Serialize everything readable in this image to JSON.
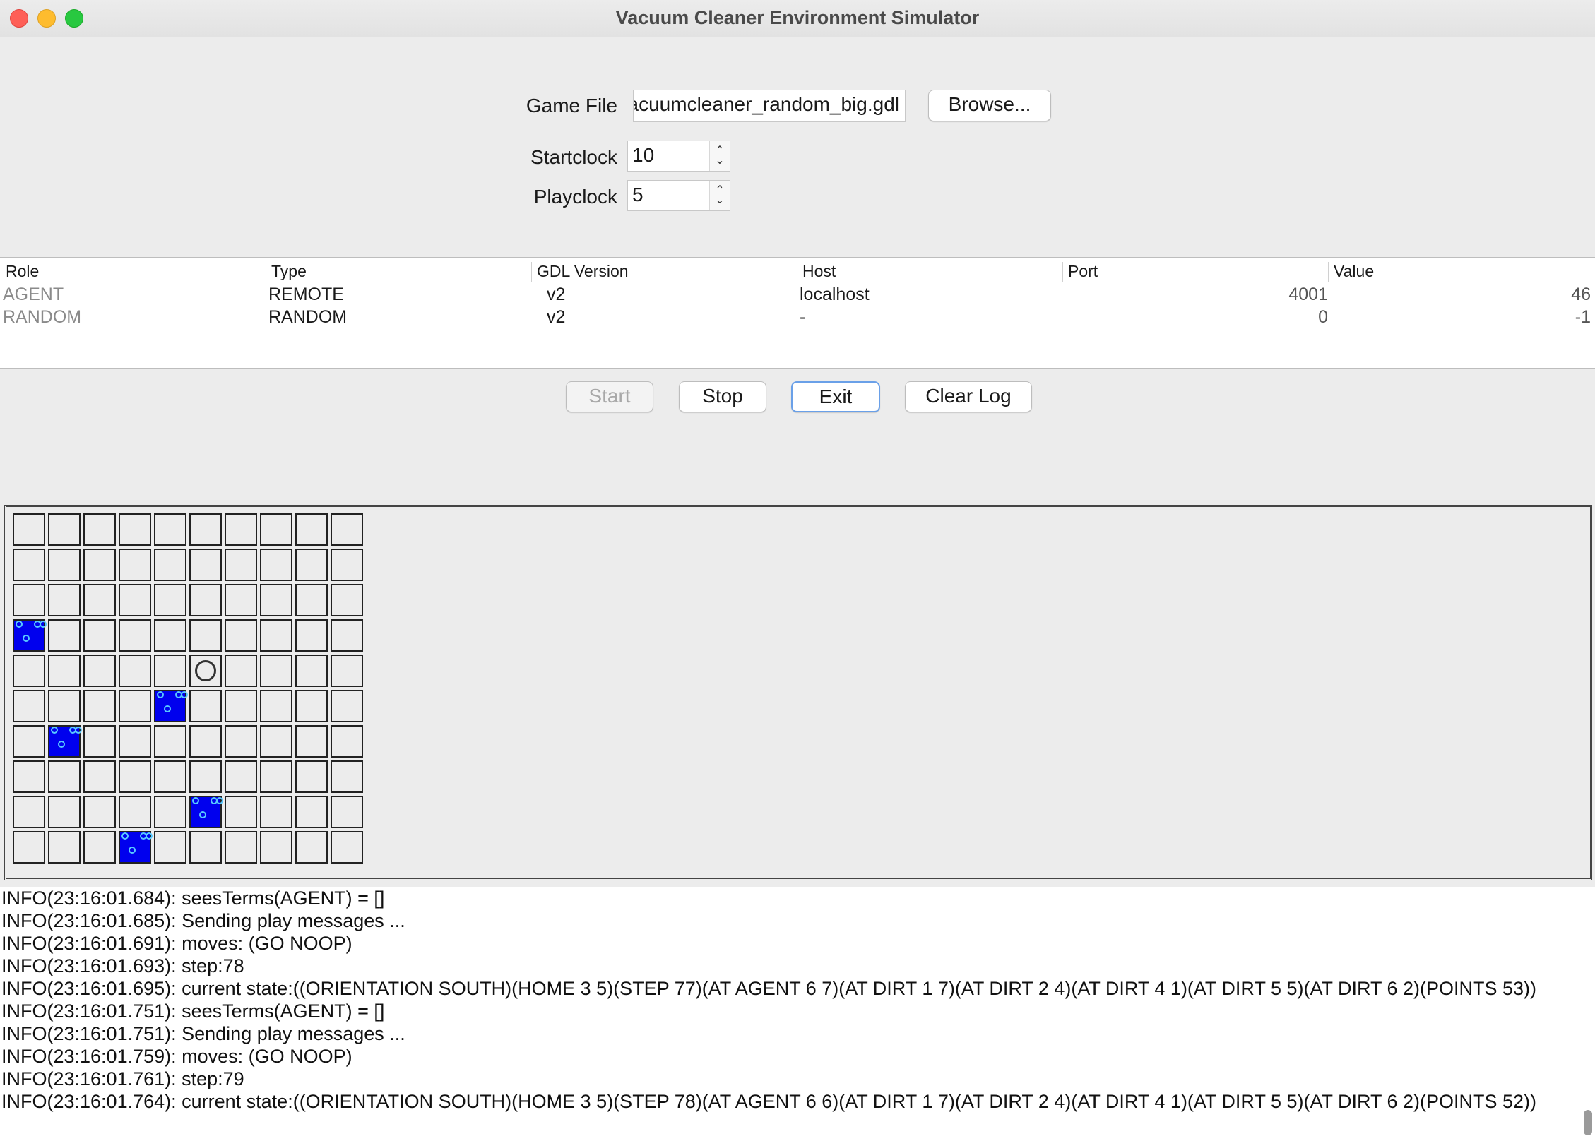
{
  "window": {
    "title": "Vacuum Cleaner Environment Simulator"
  },
  "form": {
    "game_file_label": "Game File",
    "game_file_value": "vacuumcleaner_random_big.gdl",
    "browse_label": "Browse...",
    "startclock_label": "Startclock",
    "startclock_value": "10",
    "playclock_label": "Playclock",
    "playclock_value": "5"
  },
  "table": {
    "headers": [
      "Role",
      "Type",
      "GDL Version",
      "Host",
      "Port",
      "Value"
    ],
    "rows": [
      [
        "AGENT",
        "REMOTE",
        "v2",
        "localhost",
        "4001",
        "46"
      ],
      [
        "RANDOM",
        "RANDOM",
        "v2",
        "-",
        "0",
        "-1"
      ]
    ]
  },
  "controls": {
    "start_label": "Start",
    "stop_label": "Stop",
    "exit_label": "Exit",
    "clear_log_label": "Clear Log"
  },
  "grid": {
    "columns": 10,
    "rows": 10,
    "dirt_cells": [
      [
        0,
        3
      ],
      [
        4,
        5
      ],
      [
        1,
        6
      ],
      [
        5,
        8
      ],
      [
        3,
        9
      ]
    ],
    "agent_cell": [
      5,
      4
    ],
    "colors": {
      "dirt": "#0000ee",
      "dirt_dot": "#58c8ff",
      "agent": "#333333"
    }
  },
  "log": {
    "lines": [
      "INFO(23:16:01.684): seesTerms(AGENT) = []",
      "INFO(23:16:01.685): Sending play messages ...",
      "INFO(23:16:01.691): moves: (GO NOOP)",
      "INFO(23:16:01.693): step:78",
      "INFO(23:16:01.695): current state:((ORIENTATION SOUTH)(HOME 3 5)(STEP 77)(AT AGENT 6 7)(AT DIRT 1 7)(AT DIRT 2 4)(AT DIRT 4 1)(AT DIRT 5 5)(AT DIRT 6 2)(POINTS 53))",
      "INFO(23:16:01.751): seesTerms(AGENT) = []",
      "INFO(23:16:01.751): Sending play messages ...",
      "INFO(23:16:01.759): moves: (GO NOOP)",
      "INFO(23:16:01.761): step:79",
      "INFO(23:16:01.764): current state:((ORIENTATION SOUTH)(HOME 3 5)(STEP 78)(AT AGENT 6 6)(AT DIRT 1 7)(AT DIRT 2 4)(AT DIRT 4 1)(AT DIRT 5 5)(AT DIRT 6 2)(POINTS 52))"
    ]
  }
}
